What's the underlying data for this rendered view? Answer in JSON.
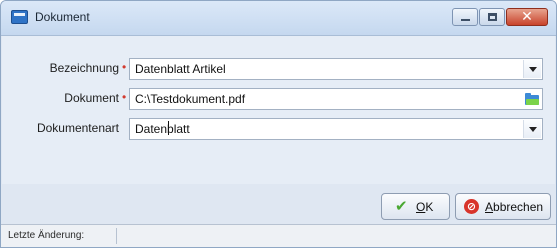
{
  "window": {
    "title": "Dokument",
    "icon": "document-window-icon"
  },
  "form": {
    "fields": [
      {
        "label": "Bezeichnung",
        "required": true,
        "value": "Datenblatt Artikel",
        "control": "dropdown"
      },
      {
        "label": "Dokument",
        "required": true,
        "value": "C:\\Testdokument.pdf",
        "control": "file-browse"
      },
      {
        "label": "Dokumentenart",
        "required": false,
        "value": "Datenblatt",
        "control": "dropdown"
      }
    ],
    "required_marker": "•"
  },
  "buttons": {
    "ok": {
      "mnemonic": "O",
      "rest": "K",
      "icon": "checkmark-icon"
    },
    "cancel": {
      "mnemonic": "A",
      "rest": "bbrechen",
      "icon": "cancel-circle-icon"
    }
  },
  "status": {
    "text": "Letzte Änderung:"
  },
  "colors": {
    "required_marker": "#d23b2f",
    "ok_check": "#4aa832",
    "cancel_icon": "#d8342b"
  }
}
